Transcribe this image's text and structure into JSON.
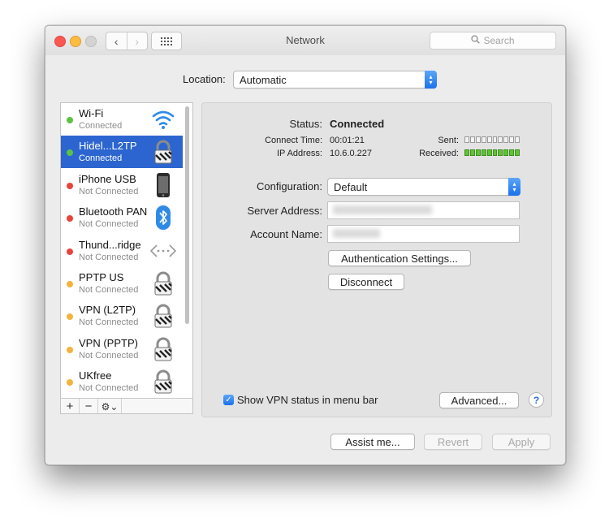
{
  "window": {
    "title": "Network",
    "search_placeholder": "Search"
  },
  "location": {
    "label": "Location:",
    "value": "Automatic"
  },
  "services": [
    {
      "name": "Wi-Fi",
      "status": "Connected",
      "status_color": "#5cc244",
      "icon": "wifi-icon"
    },
    {
      "name": "Hidel...L2TP",
      "status": "Connected",
      "status_color": "#5cc244",
      "icon": "lock-icon"
    },
    {
      "name": "iPhone USB",
      "status": "Not Connected",
      "status_color": "#e8443b",
      "icon": "iphone-icon"
    },
    {
      "name": "Bluetooth PAN",
      "status": "Not Connected",
      "status_color": "#e8443b",
      "icon": "bluetooth-icon"
    },
    {
      "name": "Thund...ridge",
      "status": "Not Connected",
      "status_color": "#e8443b",
      "icon": "thunderbolt-bridge-icon"
    },
    {
      "name": "PPTP US",
      "status": "Not Connected",
      "status_color": "#f3b33d",
      "icon": "lock-icon"
    },
    {
      "name": "VPN (L2TP)",
      "status": "Not Connected",
      "status_color": "#f3b33d",
      "icon": "lock-icon"
    },
    {
      "name": "VPN (PPTP)",
      "status": "Not Connected",
      "status_color": "#f3b33d",
      "icon": "lock-icon"
    },
    {
      "name": "UKfree",
      "status": "Not Connected",
      "status_color": "#f3b33d",
      "icon": "lock-icon"
    }
  ],
  "selected_service": "Hidel...L2TP",
  "sidebar_tools": {
    "add": "+",
    "remove": "−",
    "gear": "⚙⌄"
  },
  "detail": {
    "status_label": "Status:",
    "status_value": "Connected",
    "connect_time_label": "Connect Time:",
    "connect_time_value": "00:01:21",
    "ip_label": "IP Address:",
    "ip_value": "10.6.0.227",
    "sent_label": "Sent:",
    "received_label": "Received:",
    "configuration_label": "Configuration:",
    "configuration_value": "Default",
    "server_address_label": "Server Address:",
    "account_name_label": "Account Name:",
    "auth_settings_button": "Authentication Settings...",
    "disconnect_button": "Disconnect",
    "show_vpn_status_label": "Show VPN status in menu bar",
    "show_vpn_status_checked": true,
    "advanced_button": "Advanced...",
    "help_button": "?"
  },
  "footer": {
    "assist_button": "Assist me...",
    "revert_button": "Revert",
    "apply_button": "Apply"
  }
}
